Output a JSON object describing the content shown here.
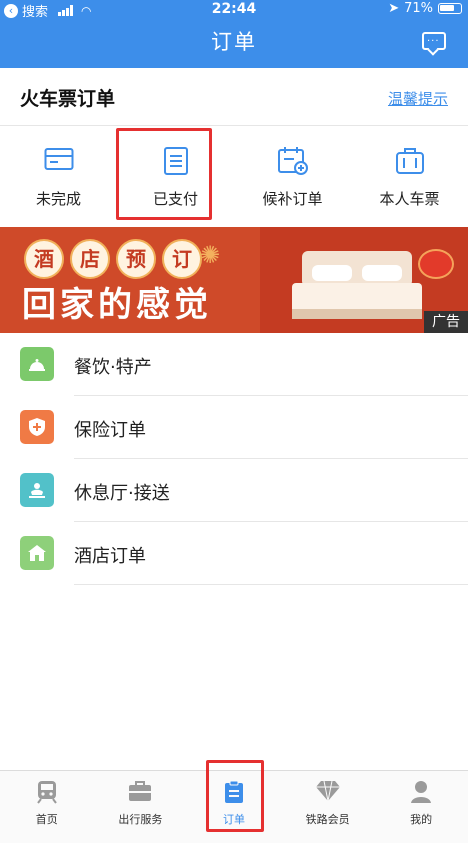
{
  "status_bar": {
    "back_label": "搜索",
    "time": "22:44",
    "battery": "71%"
  },
  "nav": {
    "title": "订单",
    "message_icon": "message-icon"
  },
  "section": {
    "title": "火车票订单",
    "tips_link": "温馨提示"
  },
  "quick_entries": [
    {
      "label": "未完成",
      "icon": "card-icon"
    },
    {
      "label": "已支付",
      "icon": "paid-list-icon"
    },
    {
      "label": "候补订单",
      "icon": "waitlist-calendar-icon"
    },
    {
      "label": "本人车票",
      "icon": "suitcase-icon"
    }
  ],
  "banner": {
    "chips": [
      "酒",
      "店",
      "预",
      "订"
    ],
    "slogan": "回家的感觉",
    "ad_label": "广告"
  },
  "services": [
    {
      "label": "餐饮·特产",
      "icon": "bell-cloche-icon",
      "color": "#7cc96b"
    },
    {
      "label": "保险订单",
      "icon": "shield-cross-icon",
      "color": "#f07a45"
    },
    {
      "label": "休息厅·接送",
      "icon": "lounge-icon",
      "color": "#52c1c9"
    },
    {
      "label": "酒店订单",
      "icon": "hotel-icon",
      "color": "#8ed07a"
    }
  ],
  "tabs": [
    {
      "label": "首页",
      "icon": "train-icon"
    },
    {
      "label": "出行服务",
      "icon": "briefcase-icon"
    },
    {
      "label": "订单",
      "icon": "clipboard-icon",
      "active": true
    },
    {
      "label": "铁路会员",
      "icon": "diamond-icon"
    },
    {
      "label": "我的",
      "icon": "person-icon"
    }
  ],
  "colors": {
    "primary": "#3d8eea",
    "highlight": "#e53030",
    "banner_red": "#c43b22"
  }
}
